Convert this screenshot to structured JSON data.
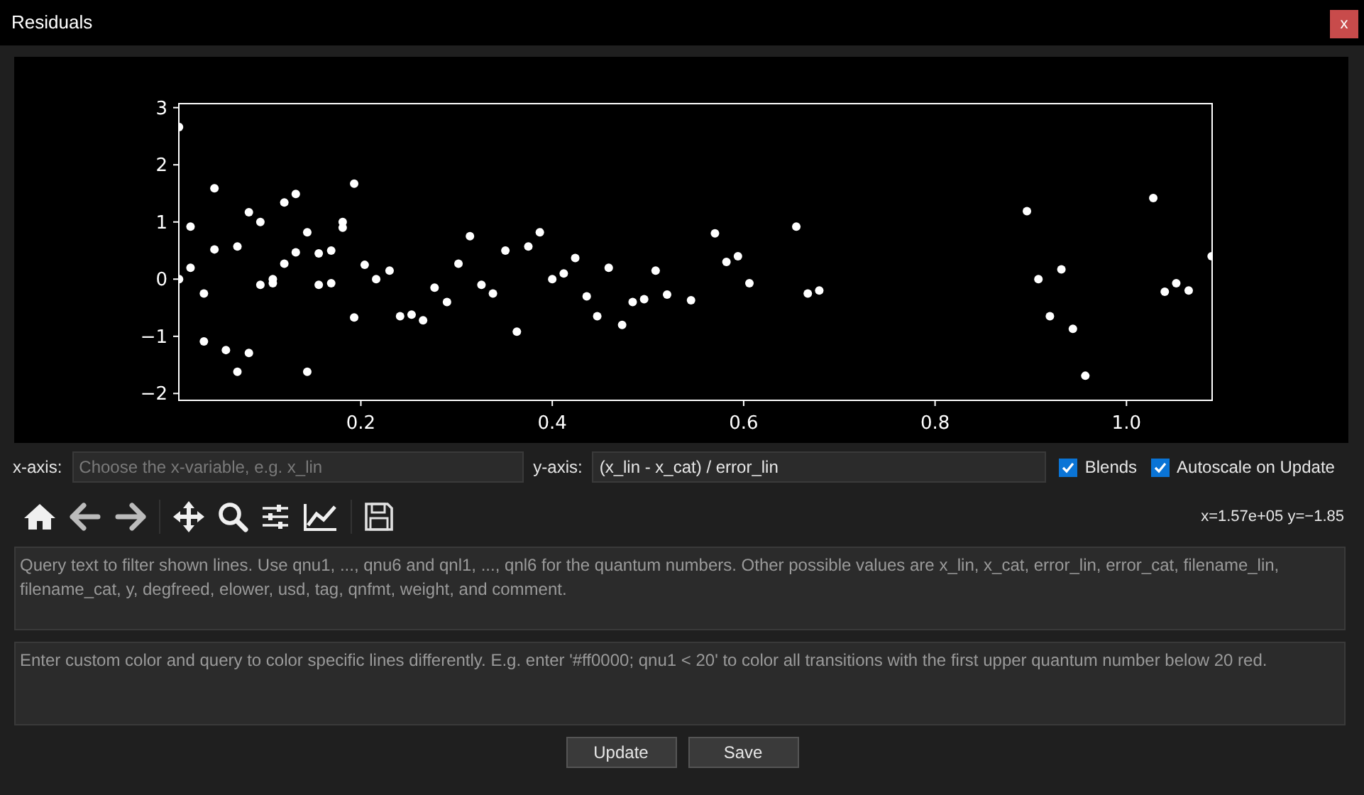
{
  "window": {
    "title": "Residuals",
    "close_label": "x"
  },
  "plot": {
    "chart_data": {
      "type": "scatter",
      "xlim": [
        0.0098,
        1.0895
      ],
      "ylim": [
        -2.12,
        3.07
      ],
      "xticks": [
        {
          "value": 0.2,
          "label": "0.2"
        },
        {
          "value": 0.4,
          "label": "0.4"
        },
        {
          "value": 0.6,
          "label": "0.6"
        },
        {
          "value": 0.8,
          "label": "0.8"
        },
        {
          "value": 1.0,
          "label": "1.0"
        }
      ],
      "yticks": [
        {
          "value": -2,
          "label": "−2"
        },
        {
          "value": -1,
          "label": "−1"
        },
        {
          "value": 0,
          "label": "0"
        },
        {
          "value": 1,
          "label": "1"
        },
        {
          "value": 2,
          "label": "2"
        },
        {
          "value": 3,
          "label": "3"
        }
      ],
      "x": [
        0.01,
        0.01,
        0.022,
        0.022,
        0.036,
        0.036,
        0.047,
        0.047,
        0.059,
        0.071,
        0.071,
        0.083,
        0.083,
        0.095,
        0.095,
        0.108,
        0.108,
        0.12,
        0.12,
        0.132,
        0.132,
        0.144,
        0.144,
        0.156,
        0.156,
        0.169,
        0.169,
        0.181,
        0.181,
        0.193,
        0.193,
        0.204,
        0.216,
        0.23,
        0.241,
        0.253,
        0.265,
        0.277,
        0.29,
        0.302,
        0.314,
        0.326,
        0.338,
        0.351,
        0.363,
        0.375,
        0.387,
        0.4,
        0.412,
        0.424,
        0.436,
        0.447,
        0.459,
        0.473,
        0.484,
        0.496,
        0.508,
        0.52,
        0.545,
        0.57,
        0.582,
        0.594,
        0.606,
        0.655,
        0.667,
        0.679,
        0.896,
        0.908,
        0.92,
        0.932,
        0.944,
        0.957,
        1.028,
        1.04,
        1.052,
        1.065,
        1.089
      ],
      "series": [
        {
          "color": "#ffffff",
          "values": [
            2.66,
            0,
            0.92,
            0.2,
            -0.25,
            -1.09,
            1.59,
            0.52,
            -1.24,
            0.57,
            -1.62,
            1.17,
            -1.29,
            1.0,
            -0.1,
            -0.07,
            0,
            1.34,
            0.27,
            1.49,
            0.47,
            0.82,
            -1.62,
            -0.1,
            0.45,
            0.5,
            -0.07,
            0.9,
            1.0,
            1.67,
            -0.67,
            0.25,
            0,
            0.15,
            -0.65,
            -0.62,
            -0.72,
            -0.15,
            -0.4,
            0.27,
            0.75,
            -0.1,
            -0.25,
            0.5,
            -0.92,
            0.57,
            0.82,
            0,
            0.1,
            0.37,
            -0.3,
            -0.65,
            0.2,
            -0.8,
            -0.4,
            -0.35,
            0.15,
            -0.27,
            -0.37,
            0.8,
            0.3,
            0.4,
            -0.07,
            0.92,
            -0.25,
            -0.2,
            1.19,
            0,
            -0.65,
            0.17,
            -0.87,
            -1.69,
            1.42,
            -0.22,
            -0.07,
            -0.2,
            0.4
          ]
        }
      ]
    }
  },
  "axis_controls": {
    "x_axis": {
      "label": "x-axis:",
      "placeholder": "Choose the x-variable, e.g. x_lin"
    },
    "y_axis": {
      "label": "y-axis:",
      "value": "(x_lin - x_cat) / error_lin"
    },
    "checkboxes": [
      {
        "label": "Blends",
        "checked": true
      },
      {
        "label": "Autoscale on Update",
        "checked": true
      }
    ]
  },
  "toolbar": {
    "coordinates": "x=1.57e+05 y=−1.85"
  },
  "query": {
    "placeholder": "Query text to filter shown lines. Use qnu1, ..., qnu6 and qnl1, ..., qnl6 for the quantum numbers. Other possible values are x_lin, x_cat, error_lin, error_cat, filename_lin, filename_cat, y, degfreed, elower, usd, tag, qnfmt, weight, and comment."
  },
  "color_query": {
    "placeholder": "Enter custom color and query to color specific lines differently. E.g. enter '#ff0000; qnu1 < 20' to color all transitions with the first upper quantum number below 20 red."
  },
  "buttons": [
    {
      "label": "Update"
    },
    {
      "label": "Save"
    }
  ]
}
